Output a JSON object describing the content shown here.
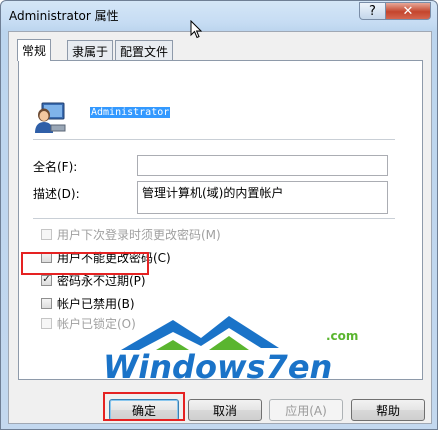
{
  "window": {
    "title": "Administrator 属性",
    "help_glyph": "?",
    "close_glyph": "✕"
  },
  "tabs": [
    {
      "label": "常规",
      "active": true
    },
    {
      "label": "隶属于",
      "active": false
    },
    {
      "label": "配置文件",
      "active": false
    }
  ],
  "user": {
    "name": "Administrator",
    "icon": "user-icon"
  },
  "fields": {
    "fullname_label": "全名(F):",
    "fullname_value": "",
    "description_label": "描述(D):",
    "description_value": "管理计算机(域)的内置帐户"
  },
  "checkboxes": [
    {
      "label": "用户下次登录时须更改密码(M)",
      "checked": false,
      "enabled": false
    },
    {
      "label": "用户不能更改密码(C)",
      "checked": false,
      "enabled": true
    },
    {
      "label": "密码永不过期(P)",
      "checked": true,
      "enabled": true
    },
    {
      "label": "帐户已禁用(B)",
      "checked": false,
      "enabled": true
    },
    {
      "label": "帐户已锁定(O)",
      "checked": false,
      "enabled": false
    }
  ],
  "watermark": {
    "text": "Windows7en",
    "suffix": ".com",
    "colors": {
      "blue": "#1a73c8",
      "green": "#5ab52f"
    }
  },
  "buttons": {
    "ok": "确定",
    "cancel": "取消",
    "apply": "应用(A)",
    "help": "帮助"
  },
  "highlight_color": "#e52222"
}
